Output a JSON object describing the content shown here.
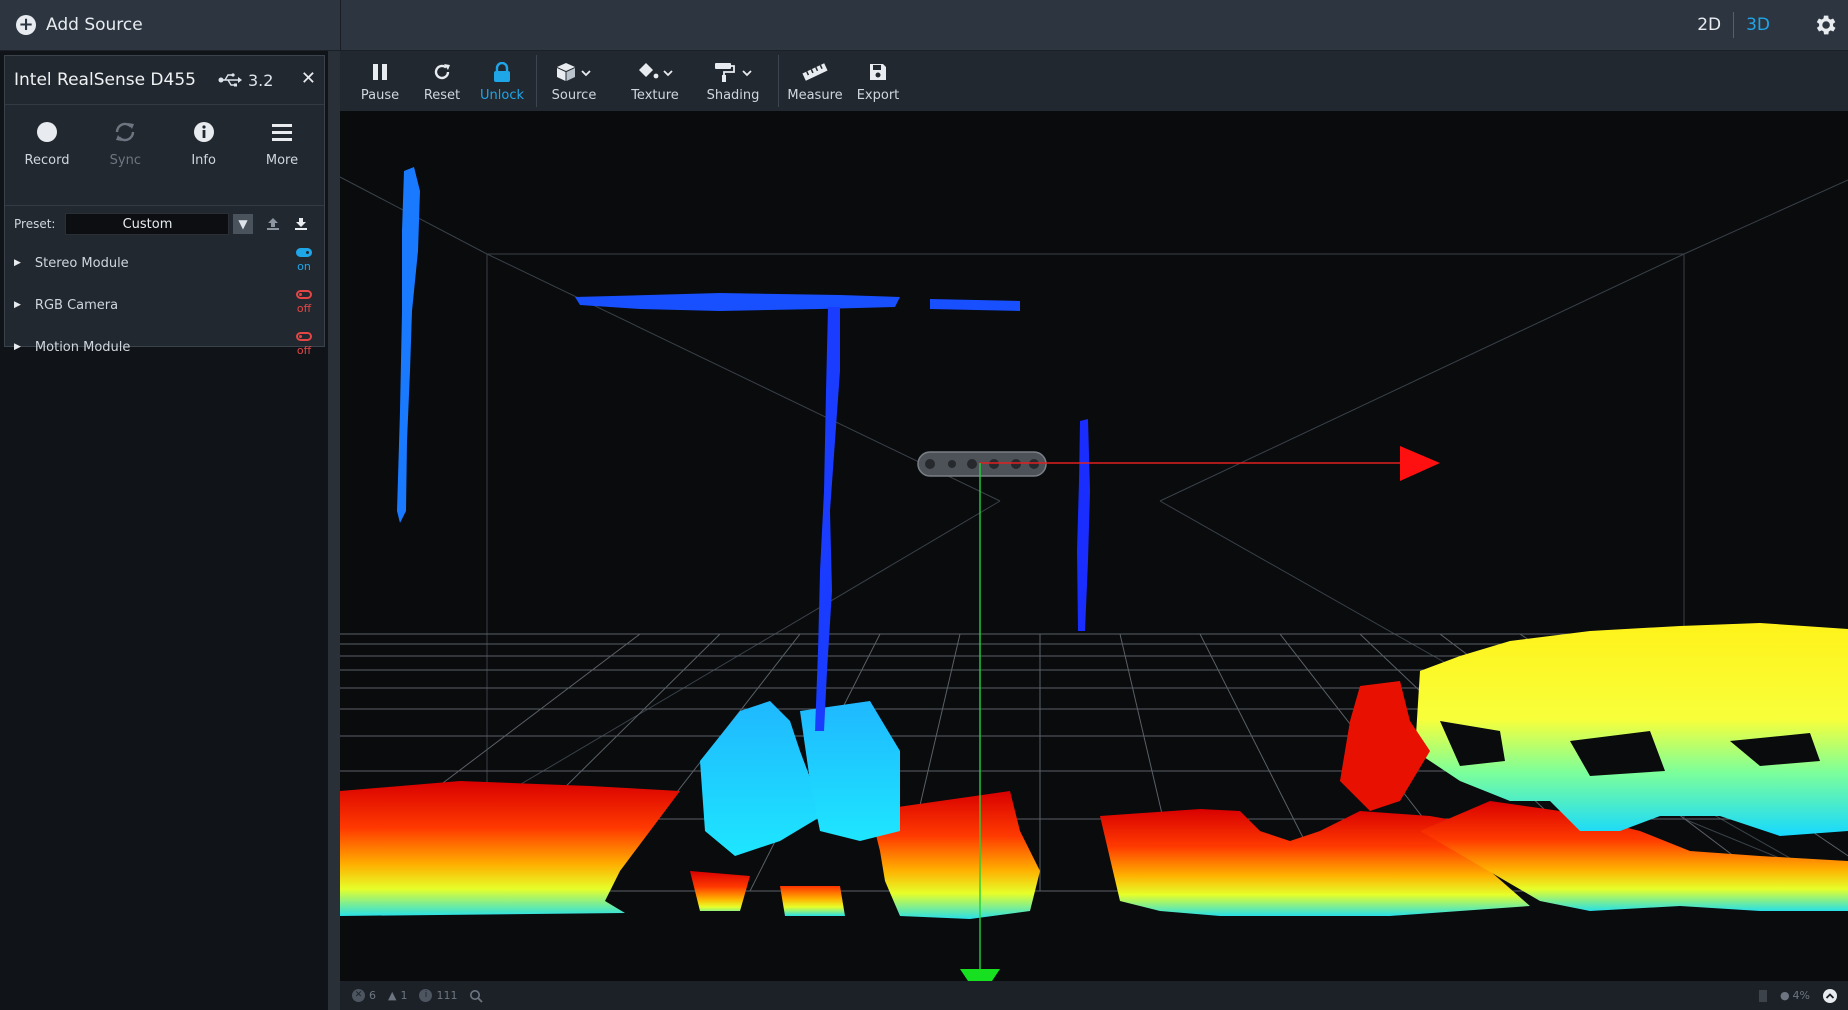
{
  "topbar": {
    "add_source_label": "Add Source",
    "view_2d": "2D",
    "view_3d": "3D"
  },
  "device": {
    "name": "Intel RealSense D455",
    "usb_version": "3.2",
    "actions": [
      {
        "label": "Record",
        "icon": "record-icon",
        "enabled": true
      },
      {
        "label": "Sync",
        "icon": "sync-icon",
        "enabled": false
      },
      {
        "label": "Info",
        "icon": "info-icon",
        "enabled": true
      },
      {
        "label": "More",
        "icon": "menu-icon",
        "enabled": true
      }
    ],
    "preset_label": "Preset:",
    "preset_value": "Custom",
    "modules": [
      {
        "label": "Stereo Module",
        "state": "on"
      },
      {
        "label": "RGB Camera",
        "state": "off"
      },
      {
        "label": "Motion Module",
        "state": "off"
      }
    ]
  },
  "toolbar": {
    "pause": "Pause",
    "reset": "Reset",
    "unlock": "Unlock",
    "source": "Source",
    "texture": "Texture",
    "shading": "Shading",
    "measure": "Measure",
    "export": "Export"
  },
  "statusbar": {
    "errors": "6",
    "warnings": "1",
    "info": "111",
    "zoom": "4%"
  },
  "colors": {
    "accent": "#1ea6e8",
    "off": "#e64545",
    "panel": "#22282f",
    "topbar": "#2d3540"
  }
}
